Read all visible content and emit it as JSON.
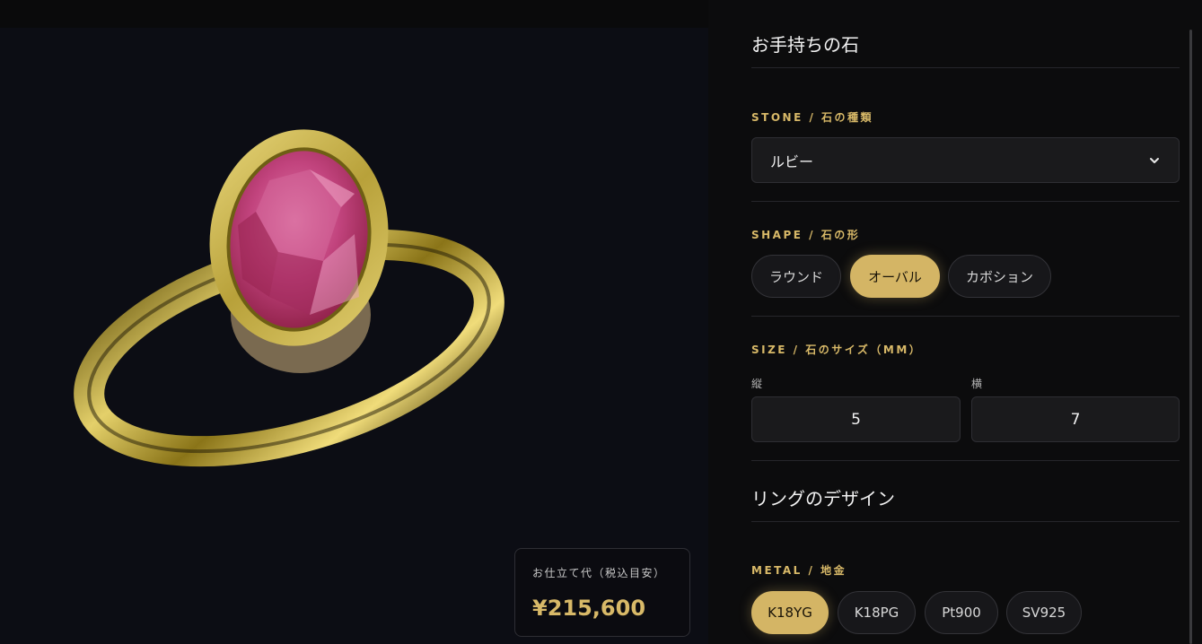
{
  "viewer": {
    "price_label": "お仕立て代（税込目安）",
    "price_value": "¥215,600"
  },
  "stone_section": {
    "title": "お手持ちの石",
    "stone_label": "STONE / 石の種類",
    "stone_value": "ルビー",
    "shape_label": "SHAPE / 石の形",
    "shapes": [
      "ラウンド",
      "オーバル",
      "カボション"
    ],
    "shape_selected": "オーバル",
    "size_label": "SIZE / 石のサイズ（MM）",
    "size_vertical_label": "縦",
    "size_vertical_value": "5",
    "size_horizontal_label": "横",
    "size_horizontal_value": "7"
  },
  "ring_section": {
    "title": "リングのデザイン",
    "metal_label": "METAL / 地金",
    "metals": [
      "K18YG",
      "K18PG",
      "Pt900",
      "SV925"
    ],
    "metal_selected": "K18YG"
  },
  "colors": {
    "accent_gold": "#d4b565",
    "stone_ruby": "#c23a78"
  },
  "icons": {
    "select_chevron": "chevron-down-icon"
  }
}
